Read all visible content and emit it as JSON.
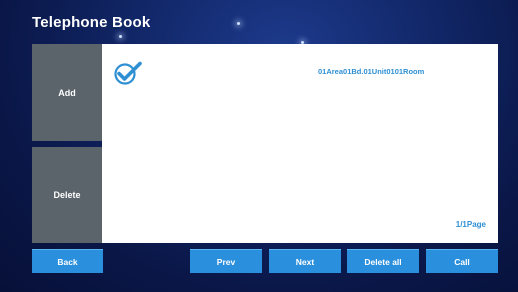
{
  "header": {
    "title": "Telephone Book"
  },
  "sidebar": {
    "add_label": "Add",
    "delete_label": "Delete"
  },
  "list": {
    "items": [
      {
        "name": "01Area01Bd.01Unit0101Room",
        "selected": true,
        "icon": "checkmark-icon"
      }
    ],
    "page_indicator": "1/1Page"
  },
  "footer": {
    "back_label": "Back",
    "prev_label": "Prev",
    "next_label": "Next",
    "delete_all_label": "Delete all",
    "call_label": "Call"
  },
  "colors": {
    "background": "#0d1a55",
    "side_button": "#5b636b",
    "action_button": "#2a8fdc",
    "accent_text": "#2f8fd3"
  }
}
